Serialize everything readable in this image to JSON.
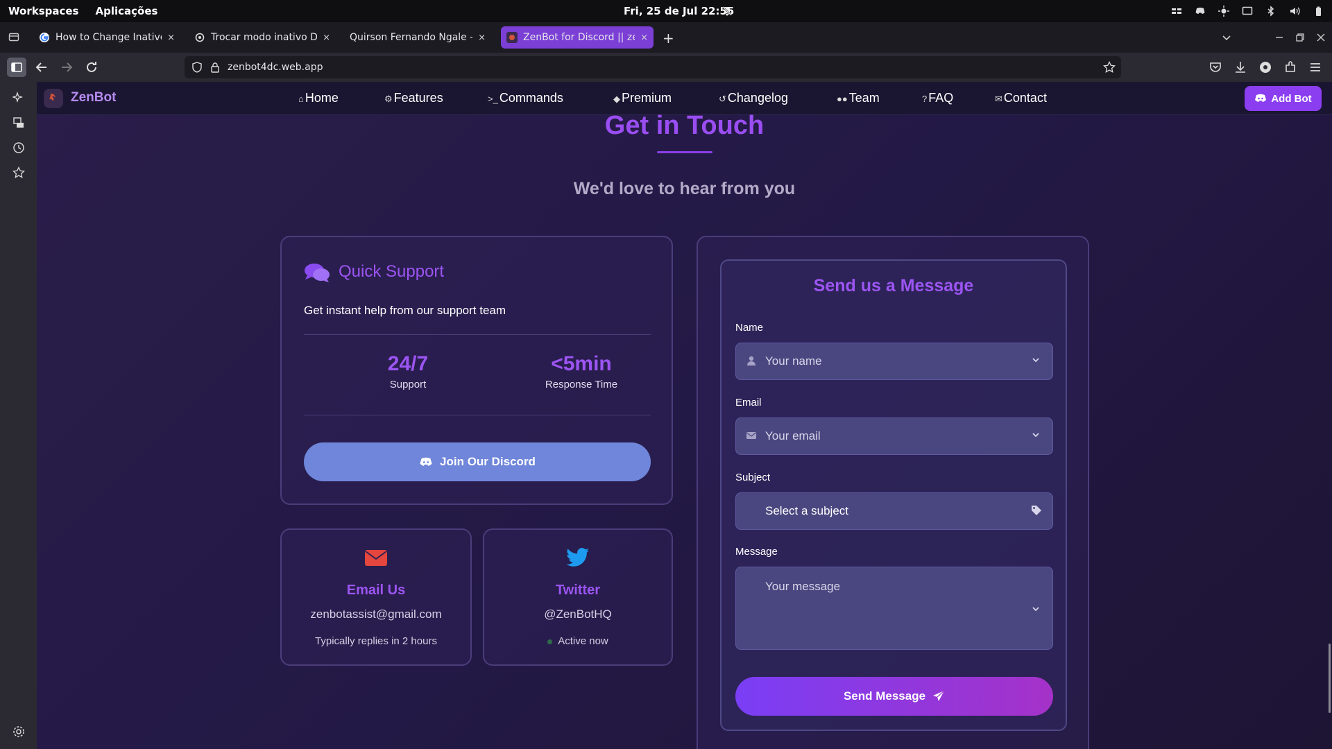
{
  "system_bar": {
    "workspaces": "Workspaces",
    "apps": "Aplicações",
    "clock": "Fri, 25 de Jul  22:55"
  },
  "browser": {
    "tabs": [
      {
        "title": "How to Change Inative Mod",
        "active": false
      },
      {
        "title": "Trocar modo inativo Discor",
        "active": false
      },
      {
        "title": "Quirson Fernando Ngale - Dese",
        "active": false
      },
      {
        "title": "ZenBot for Discord || zenbo",
        "active": true
      }
    ],
    "new_tab": "+",
    "close_glyph": "×",
    "url": "zenbot4dc.web.app"
  },
  "site": {
    "brand": "ZenBot",
    "nav": [
      {
        "label": "Home",
        "icon": "home-icon"
      },
      {
        "label": "Features",
        "icon": "gears-icon"
      },
      {
        "label": "Commands",
        "icon": "terminal-icon"
      },
      {
        "label": "Premium",
        "icon": "gem-icon"
      },
      {
        "label": "Changelog",
        "icon": "history-icon"
      },
      {
        "label": "Team",
        "icon": "users-icon"
      },
      {
        "label": "FAQ",
        "icon": "question-icon"
      },
      {
        "label": "Contact",
        "icon": "envelope-icon"
      }
    ],
    "add_bot": "Add Bot"
  },
  "contact": {
    "heading": "Get in Touch",
    "subheading": "We'd love to hear from you",
    "quick_support": {
      "title": "Quick Support",
      "description": "Get instant help from our support team",
      "stats": [
        {
          "value": "24/7",
          "label": "Support"
        },
        {
          "value": "<5min",
          "label": "Response Time"
        }
      ],
      "button": "Join Our Discord"
    },
    "email_card": {
      "title": "Email Us",
      "value": "zenbotassist@gmail.com",
      "note": "Typically replies in 2 hours"
    },
    "twitter_card": {
      "title": "Twitter",
      "value": "@ZenBotHQ",
      "note": "Active now"
    },
    "form": {
      "title": "Send us a Message",
      "name_label": "Name",
      "name_placeholder": "Your name",
      "email_label": "Email",
      "email_placeholder": "Your email",
      "subject_label": "Subject",
      "subject_value": "Select a subject",
      "message_label": "Message",
      "message_placeholder": "Your message",
      "submit": "Send Message"
    }
  },
  "colors": {
    "accent": "#9c55f2",
    "discord_button": "#6f86da",
    "email_icon": "#e5463d",
    "twitter_icon": "#1d9bf0"
  }
}
